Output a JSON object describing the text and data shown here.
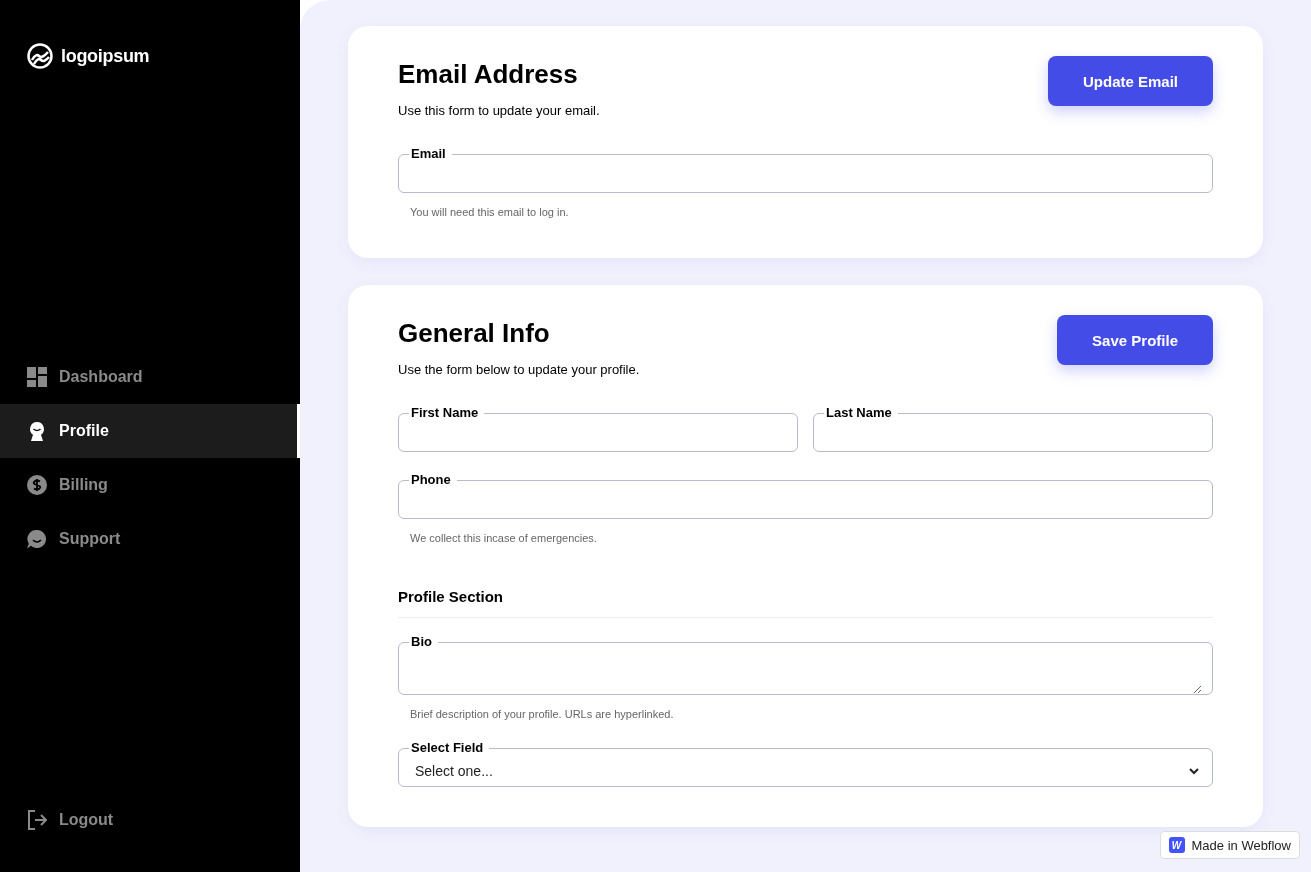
{
  "brand": {
    "name": "logoipsum"
  },
  "nav": [
    {
      "label": "Dashboard",
      "selected": false
    },
    {
      "label": "Profile",
      "selected": true
    },
    {
      "label": "Billing",
      "selected": false
    },
    {
      "label": "Support",
      "selected": false
    }
  ],
  "logout": {
    "label": "Logout"
  },
  "cards": [
    {
      "title": "Email Address",
      "subtitle": "Use this form to update your email.",
      "button": "Update Email",
      "fields": [
        {
          "kind": "input",
          "label": "Email",
          "hint": "You will need this email to log in."
        }
      ]
    },
    {
      "title": "General Info",
      "subtitle": "Use the form below to update your profile.",
      "button": "Save Profile",
      "fields": [
        {
          "kind": "row",
          "fields": [
            {
              "kind": "input",
              "label": "First Name"
            },
            {
              "kind": "input",
              "label": "Last Name"
            }
          ]
        },
        {
          "kind": "input",
          "label": "Phone",
          "hint": "We collect this incase of emergencies."
        },
        {
          "kind": "heading",
          "text": "Profile Section"
        },
        {
          "kind": "textarea",
          "label": "Bio",
          "hint": "Brief description of your profile. URLs are hyperlinked."
        },
        {
          "kind": "select",
          "label": "Select Field",
          "value": "Select one..."
        }
      ]
    }
  ],
  "badge": {
    "mark": "W",
    "label": "Made in Webflow"
  }
}
